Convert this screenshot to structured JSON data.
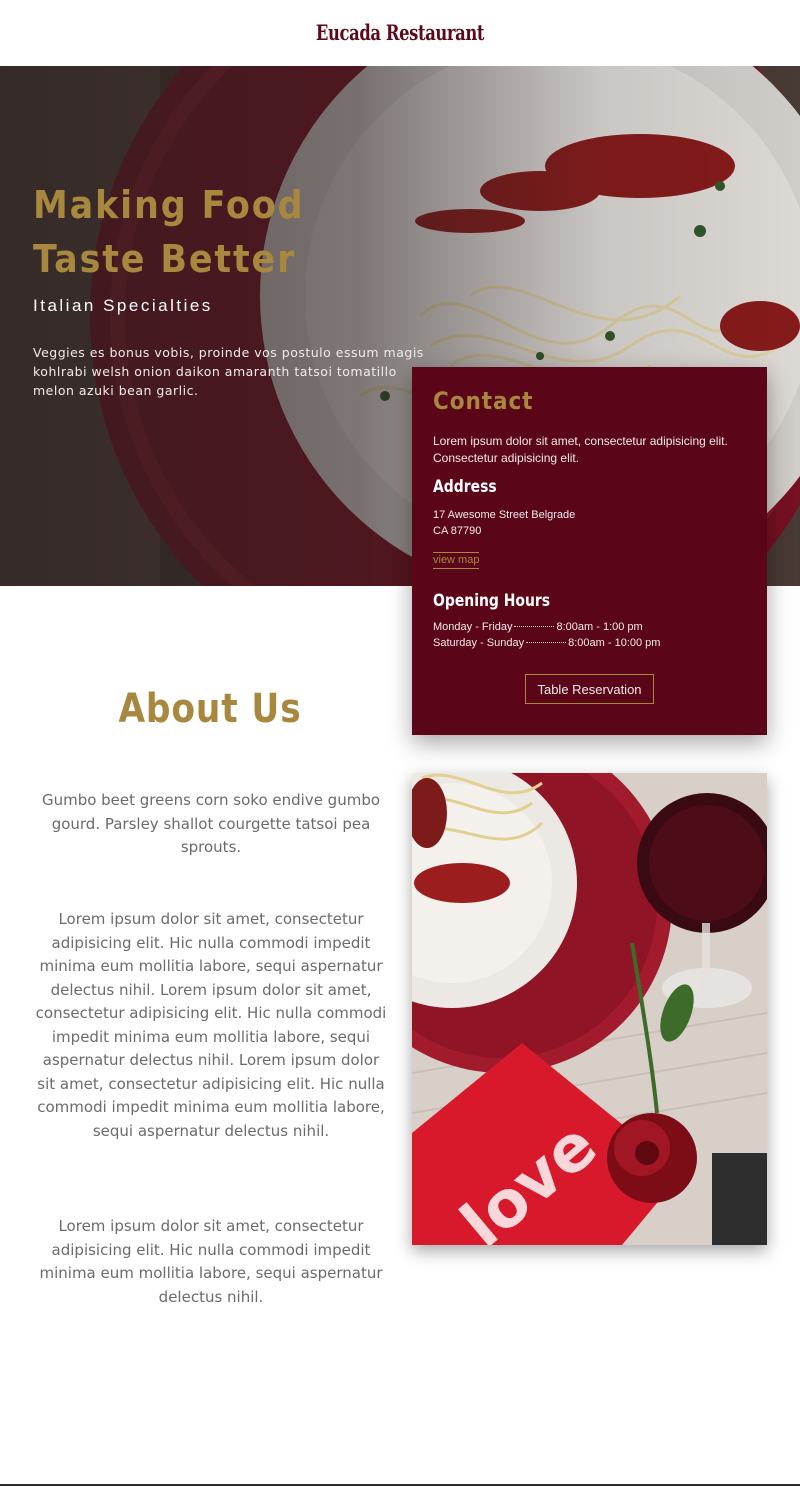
{
  "header": {
    "brand": "Eucada Restaurant"
  },
  "hero": {
    "title": "Making Food Taste Better",
    "subtitle": "Italian Specialties",
    "text": "Veggies es bonus vobis, proinde vos postulo essum magis kohlrabi welsh onion daikon amaranth tatsoi tomatillo melon azuki bean garlic."
  },
  "contact": {
    "title": "Contact",
    "intro": "Lorem ipsum dolor sit amet, consectetur adipisicing elit. Consectetur adipisicing elit.",
    "address_heading": "Address",
    "address_line1": "17 Awesome Street Belgrade",
    "address_line2": "CA 87790",
    "map_link": "view map",
    "hours_heading": "Opening Hours",
    "hours": [
      {
        "day": "Monday - Friday",
        "time": "8:00am - 1:00 pm"
      },
      {
        "day": "Saturday - Sunday",
        "time": "8:00am - 10:00 pm"
      }
    ],
    "reservation_button": "Table Reservation"
  },
  "about": {
    "title": "About Us",
    "paragraphs": [
      "Gumbo beet greens corn soko endive gumbo gourd. Parsley shallot courgette tatsoi pea sprouts.",
      "Lorem ipsum dolor sit amet, consectetur adipisicing elit. Hic nulla commodi impedit minima eum mollitia labore, sequi aspernatur delectus nihil. Lorem ipsum dolor sit amet, consectetur adipisicing elit. Hic nulla commodi impedit minima eum mollitia labore, sequi aspernatur delectus nihil. Lorem ipsum dolor sit amet, consectetur adipisicing elit. Hic nulla commodi impedit minima eum mollitia labore, sequi aspernatur delectus nihil.",
      "Lorem ipsum dolor sit amet, consectetur adipisicing elit. Hic nulla commodi impedit minima eum mollitia labore, sequi aspernatur delectus nihil."
    ],
    "image_label": "love"
  },
  "colors": {
    "brand": "#5a0a18",
    "gold": "#a8873f",
    "card_bg": "#5a0618",
    "text_muted": "#6b6b6b"
  }
}
